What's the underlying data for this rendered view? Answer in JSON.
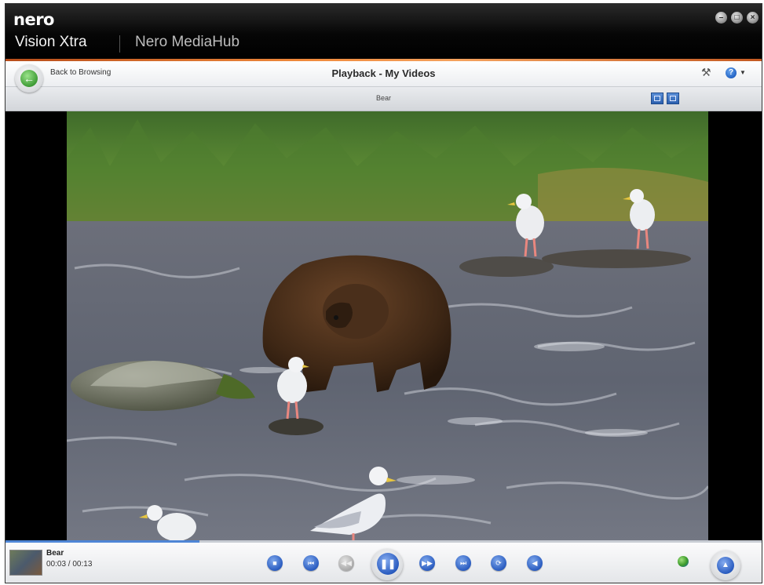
{
  "window": {
    "brand": "nero",
    "app_name": "Vision Xtra",
    "app_name_secondary": "Nero MediaHub",
    "buttons": [
      "minimize-icon",
      "maximize-icon",
      "close-icon"
    ]
  },
  "navbar": {
    "back_label": "Back to Browsing",
    "title": "Playback - My Videos",
    "tools_icon": "hammer-icon",
    "help_icon": "help-icon"
  },
  "subbar": {
    "title": "Bear",
    "view_buttons": [
      "fullscreen-icon",
      "fit-window-icon"
    ]
  },
  "player": {
    "clip_name": "Bear",
    "time": "00:03 / 00:13",
    "progress_fraction": 0.256,
    "controls": [
      "stop",
      "previous",
      "rewind",
      "pause",
      "fast-forward",
      "next",
      "repeat",
      "volume"
    ],
    "accent_color": "#2a5cc0"
  },
  "colors": {
    "titlebar": "#000000",
    "accent_line": "#f08a3c",
    "progress": "#4f86d6"
  }
}
